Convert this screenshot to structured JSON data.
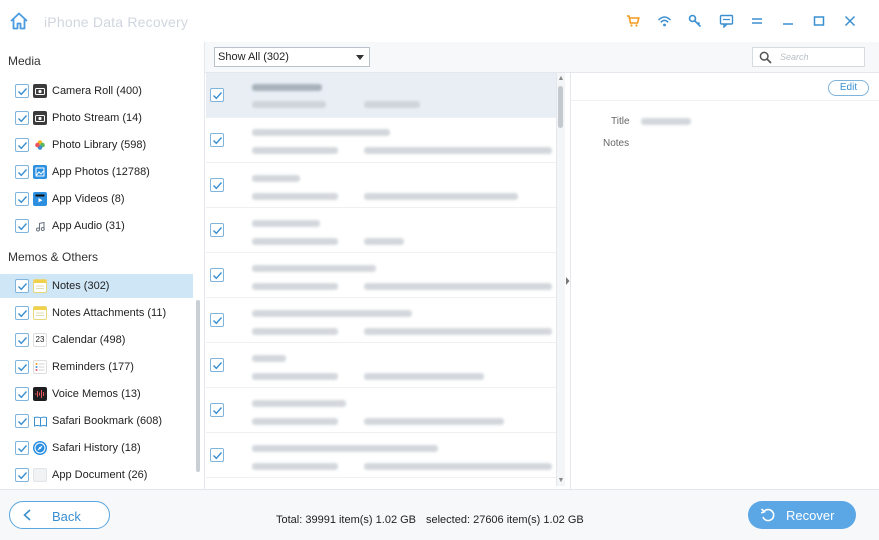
{
  "app": {
    "title": "iPhone Data Recovery"
  },
  "sidebar": {
    "sections": [
      {
        "title": "Media",
        "items": [
          {
            "label": "Camera Roll (400)",
            "icon": "camera-roll-icon"
          },
          {
            "label": "Photo Stream (14)",
            "icon": "photo-stream-icon"
          },
          {
            "label": "Photo Library (598)",
            "icon": "photo-library-icon"
          },
          {
            "label": "App Photos (12788)",
            "icon": "app-photos-icon"
          },
          {
            "label": "App Videos (8)",
            "icon": "app-videos-icon"
          },
          {
            "label": "App Audio (31)",
            "icon": "app-audio-icon"
          }
        ]
      },
      {
        "title": "Memos & Others",
        "items": [
          {
            "label": "Notes (302)",
            "icon": "notes-icon",
            "selected": true
          },
          {
            "label": "Notes Attachments (11)",
            "icon": "notes-attachments-icon"
          },
          {
            "label": "Calendar (498)",
            "icon": "calendar-icon",
            "icon_text": "23"
          },
          {
            "label": "Reminders (177)",
            "icon": "reminders-icon"
          },
          {
            "label": "Voice Memos (13)",
            "icon": "voice-memos-icon"
          },
          {
            "label": "Safari Bookmark (608)",
            "icon": "safari-bookmark-icon"
          },
          {
            "label": "Safari History (18)",
            "icon": "safari-history-icon"
          },
          {
            "label": "App Document (26)",
            "icon": "app-document-icon"
          }
        ]
      }
    ]
  },
  "list": {
    "filter_value": "Show All (302)",
    "search_placeholder": "Search",
    "row_count_visible": 9
  },
  "detail": {
    "edit_label": "Edit",
    "title_label": "Title",
    "notes_label": "Notes"
  },
  "footer": {
    "back_label": "Back",
    "total_text": "Total: 39991 item(s) 1.02 GB",
    "selected_text": "selected: 27606 item(s) 1.02 GB",
    "recover_label": "Recover"
  },
  "colors": {
    "accent": "#5ba7e6",
    "selected_row": "#cfe6f7",
    "toolbar_orange": "#f39a1e",
    "toolbar_blue": "#3a8fd1"
  }
}
